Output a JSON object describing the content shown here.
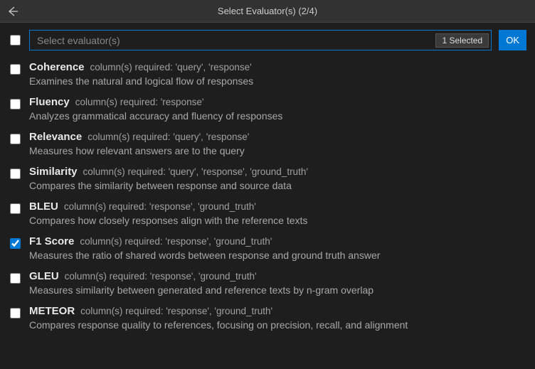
{
  "header": {
    "title": "Select Evaluator(s) (2/4)"
  },
  "search": {
    "placeholder": "Select evaluator(s)",
    "selected_badge": "1 Selected"
  },
  "ok_label": "OK",
  "master_checked": false,
  "evaluators": [
    {
      "name": "Coherence",
      "req": "column(s) required: 'query', 'response'",
      "desc": "Examines the natural and logical flow of responses",
      "checked": false
    },
    {
      "name": "Fluency",
      "req": "column(s) required: 'response'",
      "desc": "Analyzes grammatical accuracy and fluency of responses",
      "checked": false
    },
    {
      "name": "Relevance",
      "req": "column(s) required: 'query', 'response'",
      "desc": "Measures how relevant answers are to the query",
      "checked": false
    },
    {
      "name": "Similarity",
      "req": "column(s) required: 'query', 'response', 'ground_truth'",
      "desc": "Compares the similarity between response and source data",
      "checked": false
    },
    {
      "name": "BLEU",
      "req": "column(s) required: 'response', 'ground_truth'",
      "desc": "Compares how closely responses align with the reference texts",
      "checked": false
    },
    {
      "name": "F1 Score",
      "req": "column(s) required: 'response', 'ground_truth'",
      "desc": "Measures the ratio of shared words between response and ground truth answer",
      "checked": true
    },
    {
      "name": "GLEU",
      "req": "column(s) required: 'response', 'ground_truth'",
      "desc": "Measures similarity between generated and reference texts by n-gram overlap",
      "checked": false
    },
    {
      "name": "METEOR",
      "req": "column(s) required: 'response', 'ground_truth'",
      "desc": "Compares response quality to references, focusing on precision, recall, and alignment",
      "checked": false
    }
  ]
}
